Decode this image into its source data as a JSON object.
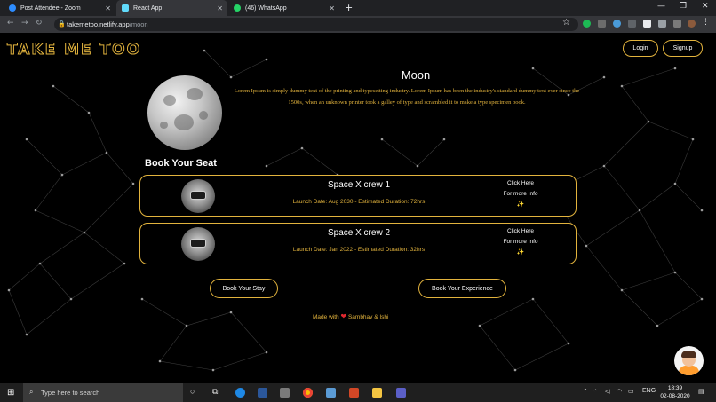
{
  "browser": {
    "tabs": [
      {
        "title": "Post Attendee - Zoom",
        "active": false
      },
      {
        "title": "React App",
        "active": true
      },
      {
        "title": "(46) WhatsApp",
        "active": false
      }
    ],
    "new_tab_label": "+",
    "url_host": "takemetoo.netlify.app",
    "url_path": "/moon"
  },
  "site": {
    "logo": "TAKE ME TOO",
    "login_label": "Login",
    "signup_label": "Signup"
  },
  "destination": {
    "title": "Moon",
    "description": "Lorem Ipsum is simply dummy text of the printing and typesetting industry. Lorem Ipsum has been the industry's standard dummy text ever since the 1500s, when an unknown printer took a galley of type and scrambled it to make a type specimen book."
  },
  "booking": {
    "heading": "Book Your Seat",
    "cards": [
      {
        "name": "Space X crew 1",
        "meta": "Launch Date: Aug 2030 - Estimated Duration: 72hrs",
        "cta_line1": "Click Here",
        "cta_line2": "For more Info",
        "spark": "✨"
      },
      {
        "name": "Space X crew 2",
        "meta": "Launch Date: Jan 2022 - Estimated Duration: 32hrs",
        "cta_line1": "Click Here",
        "cta_line2": "For more Info",
        "spark": "✨"
      }
    ],
    "book_stay_label": "Book Your Stay",
    "book_experience_label": "Book Your Experience"
  },
  "footer": {
    "made_with": "Made with",
    "heart": "❤",
    "authors": "Sambhav & Ishi"
  },
  "taskbar": {
    "search_placeholder": "Type here to search",
    "language": "ENG",
    "time": "18:39",
    "date": "02-08-2020"
  },
  "colors": {
    "accent": "#e2b33d",
    "background": "#000000"
  }
}
